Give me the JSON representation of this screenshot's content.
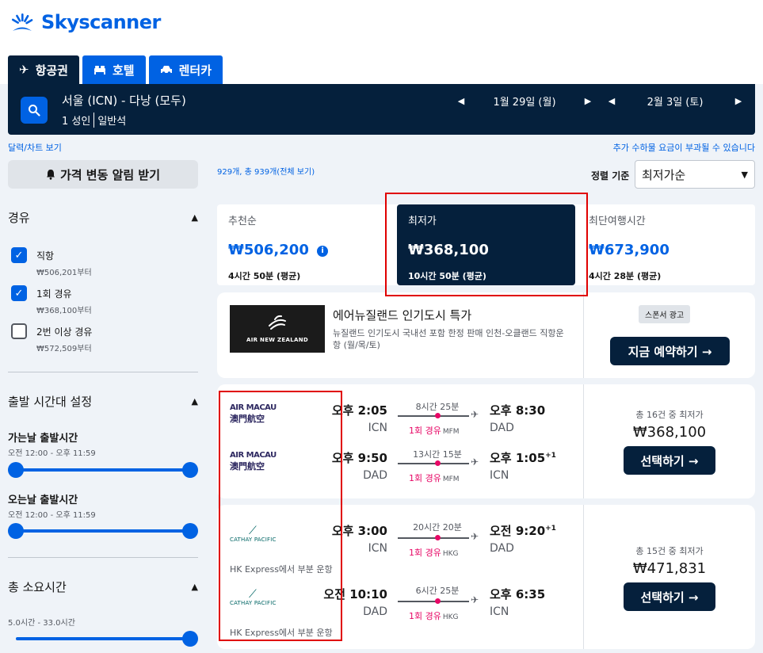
{
  "brand": {
    "name": "Skyscanner",
    "color": "#0062e3",
    "dark": "#05203c"
  },
  "tabs": [
    {
      "label": "항공권",
      "icon": "plane-icon",
      "active": true
    },
    {
      "label": "호텔",
      "icon": "bed-icon",
      "active": false
    },
    {
      "label": "렌터카",
      "icon": "car-icon",
      "active": false
    }
  ],
  "search": {
    "route": "서울 (ICN) - 다낭 (모두)",
    "passengers": "1 성인",
    "cabin": "일반석",
    "depart_date": "1월 29일 (월)",
    "return_date": "2월 3일 (토)"
  },
  "links": {
    "calendar": "달력/차트 보기",
    "fees": "추가 수하물 요금이 부과될 수 있습니다"
  },
  "alert_button": "가격 변동 알림 받기",
  "filters": {
    "stops": {
      "title": "경유",
      "options": [
        {
          "label": "직항",
          "sub": "₩506,201부터",
          "checked": true
        },
        {
          "label": "1회 경유",
          "sub": "₩368,100부터",
          "checked": true
        },
        {
          "label": "2번 이상 경유",
          "sub": "₩572,509부터",
          "checked": false
        }
      ]
    },
    "departure": {
      "title": "출발 시간대 설정",
      "outbound_title": "가는날 출발시간",
      "outbound_range": "오전 12:00 - 오후 11:59",
      "return_title": "오는날 출발시간",
      "return_range": "오전 12:00 - 오후 11:59"
    },
    "duration": {
      "title": "총 소요시간",
      "range": "5.0시간 - 33.0시간"
    }
  },
  "results": {
    "count": "929개, 총 939개(전체 보기)",
    "sort_label": "정렬 기준",
    "sort_value": "최저가순",
    "sort_cards": [
      {
        "label": "추천순",
        "price": "₩506,200",
        "duration": "4시간 50분 (평균)",
        "active": false
      },
      {
        "label": "최저가",
        "price": "₩368,100",
        "duration": "10시간 50분 (평균)",
        "active": true
      },
      {
        "label": "최단여행시간",
        "price": "₩673,900",
        "duration": "4시간 28분 (평균)",
        "active": false
      }
    ]
  },
  "ad": {
    "logo_text": "AIR NEW ZEALAND",
    "title": "에어뉴질랜드 인기도시 특가",
    "desc": "뉴질랜드 인기도시 국내선 포함 한정 판매 인천-오클랜드 직항운항 (월/목/토)",
    "badge": "스폰서 광고",
    "button": "지금 예약하기 →"
  },
  "flights": [
    {
      "airline": "AIR MACAU",
      "airline_sub": "澳門航空",
      "legs": [
        {
          "dep_time": "오후 2:05",
          "dep_code": "ICN",
          "duration": "8시간 25분",
          "arr_time": "오후 8:30",
          "arr_sup": "",
          "arr_code": "DAD",
          "stops": "1회 경유",
          "via": "MFM"
        },
        {
          "dep_time": "오후 9:50",
          "dep_code": "DAD",
          "duration": "13시간 15분",
          "arr_time": "오후 1:05",
          "arr_sup": "+1",
          "arr_code": "ICN",
          "stops": "1회 경유",
          "via": "MFM"
        }
      ],
      "deals": "총 16건 중 최저가",
      "price": "₩368,100",
      "button": "선택하기 →"
    },
    {
      "airline": "CATHAY PACIFIC",
      "operated": "HK Express에서 부분 운항",
      "legs": [
        {
          "dep_time": "오후 3:00",
          "dep_code": "ICN",
          "duration": "20시간 20분",
          "arr_time": "오전 9:20",
          "arr_sup": "+1",
          "arr_code": "DAD",
          "stops": "1회 경유",
          "via": "HKG"
        },
        {
          "dep_time": "오전 10:10",
          "dep_code": "DAD",
          "duration": "6시간 25분",
          "arr_time": "오후 6:35",
          "arr_sup": "",
          "arr_code": "ICN",
          "stops": "1회 경유",
          "via": "HKG"
        }
      ],
      "deals": "총 15건 중 최저가",
      "price": "₩471,831",
      "button": "선택하기 →"
    }
  ]
}
